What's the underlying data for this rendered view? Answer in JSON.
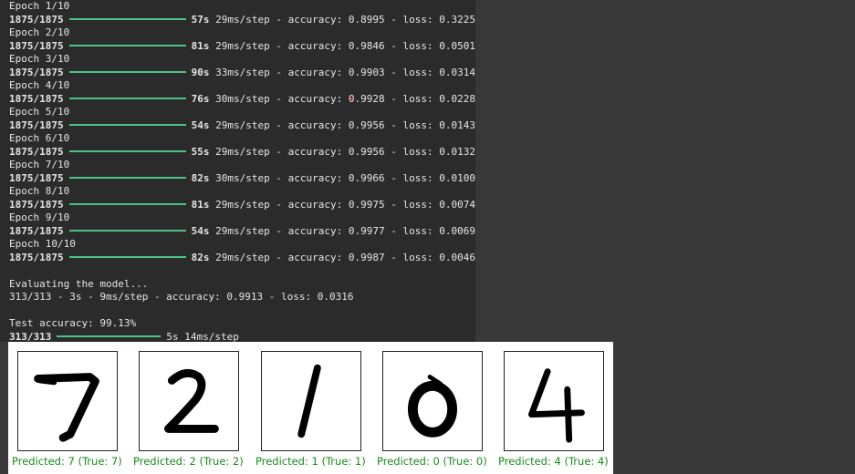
{
  "log": {
    "epochs": [
      {
        "epoch_label": "Epoch 1/10",
        "steps": "1875/1875",
        "time": "57s",
        "step_time": "29ms/step",
        "acc_label": "accuracy:",
        "acc": "0.8995",
        "loss_label": "loss:",
        "loss": "0.3225"
      },
      {
        "epoch_label": "Epoch 2/10",
        "steps": "1875/1875",
        "time": "81s",
        "step_time": "29ms/step",
        "acc_label": "accuracy:",
        "acc": "0.9846",
        "loss_label": "loss:",
        "loss": "0.0501"
      },
      {
        "epoch_label": "Epoch 3/10",
        "steps": "1875/1875",
        "time": "90s",
        "step_time": "33ms/step",
        "acc_label": "accuracy:",
        "acc": "0.9903",
        "loss_label": "loss:",
        "loss": "0.0314"
      },
      {
        "epoch_label": "Epoch 4/10",
        "steps": "1875/1875",
        "time": "76s",
        "step_time": "30ms/step",
        "acc_label": "accuracy:",
        "acc": "0.9928",
        "loss_label": "loss:",
        "loss": "0.0228"
      },
      {
        "epoch_label": "Epoch 5/10",
        "steps": "1875/1875",
        "time": "54s",
        "step_time": "29ms/step",
        "acc_label": "accuracy:",
        "acc": "0.9956",
        "loss_label": "loss:",
        "loss": "0.0143"
      },
      {
        "epoch_label": "Epoch 6/10",
        "steps": "1875/1875",
        "time": "55s",
        "step_time": "29ms/step",
        "acc_label": "accuracy:",
        "acc": "0.9956",
        "loss_label": "loss:",
        "loss": "0.0132"
      },
      {
        "epoch_label": "Epoch 7/10",
        "steps": "1875/1875",
        "time": "82s",
        "step_time": "30ms/step",
        "acc_label": "accuracy:",
        "acc": "0.9966",
        "loss_label": "loss:",
        "loss": "0.0100"
      },
      {
        "epoch_label": "Epoch 8/10",
        "steps": "1875/1875",
        "time": "81s",
        "step_time": "29ms/step",
        "acc_label": "accuracy:",
        "acc": "0.9975",
        "loss_label": "loss:",
        "loss": "0.0074"
      },
      {
        "epoch_label": "Epoch 9/10",
        "steps": "1875/1875",
        "time": "54s",
        "step_time": "29ms/step",
        "acc_label": "accuracy:",
        "acc": "0.9977",
        "loss_label": "loss:",
        "loss": "0.0069"
      },
      {
        "epoch_label": "Epoch 10/10",
        "steps": "1875/1875",
        "time": "82s",
        "step_time": "29ms/step",
        "acc_label": "accuracy:",
        "acc": "0.9987",
        "loss_label": "loss:",
        "loss": "0.0046"
      }
    ],
    "evaluating": "Evaluating the model...",
    "eval_line": "313/313 - 3s - 9ms/step - accuracy: 0.9913 - loss: 0.0316",
    "test_accuracy": "Test accuracy: 99.13%",
    "predict_steps": "313/313",
    "predict_time": "5s 14ms/step",
    "separator": " - ",
    "progress_color": "#4cc38a"
  },
  "figure": {
    "panels": [
      {
        "digit": "7",
        "caption": "Predicted: 7 (True: 7)"
      },
      {
        "digit": "2",
        "caption": "Predicted: 2 (True: 2)"
      },
      {
        "digit": "1",
        "caption": "Predicted: 1 (True: 1)"
      },
      {
        "digit": "0",
        "caption": "Predicted: 0 (True: 0)"
      },
      {
        "digit": "4",
        "caption": "Predicted: 4 (True: 4)"
      }
    ],
    "caption_color": "#1a8a1a"
  }
}
